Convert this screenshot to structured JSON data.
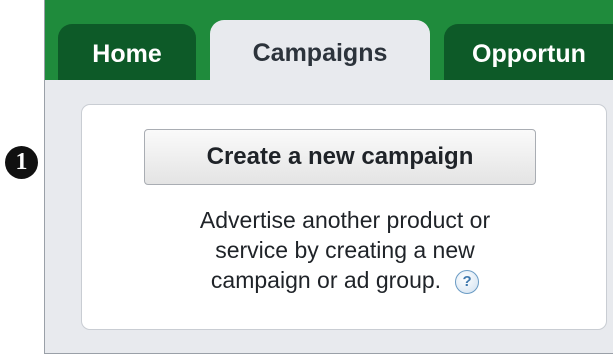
{
  "step": {
    "number": "1"
  },
  "tabs": [
    {
      "label": "Home",
      "active": false
    },
    {
      "label": "Campaigns",
      "active": true
    },
    {
      "label": "Opportun",
      "active": false
    }
  ],
  "panel": {
    "button_label": "Create a new campaign",
    "description_lines": [
      "Advertise another product or",
      "service by creating a new",
      "campaign or ad group."
    ],
    "help_icon_glyph": "?"
  },
  "colors": {
    "tabbar": "#1f8b3c",
    "inactive_tab": "#0d5a28",
    "background": "#e8eaee",
    "help_icon": "#3f78ad"
  },
  "icons": [
    "help-icon"
  ]
}
